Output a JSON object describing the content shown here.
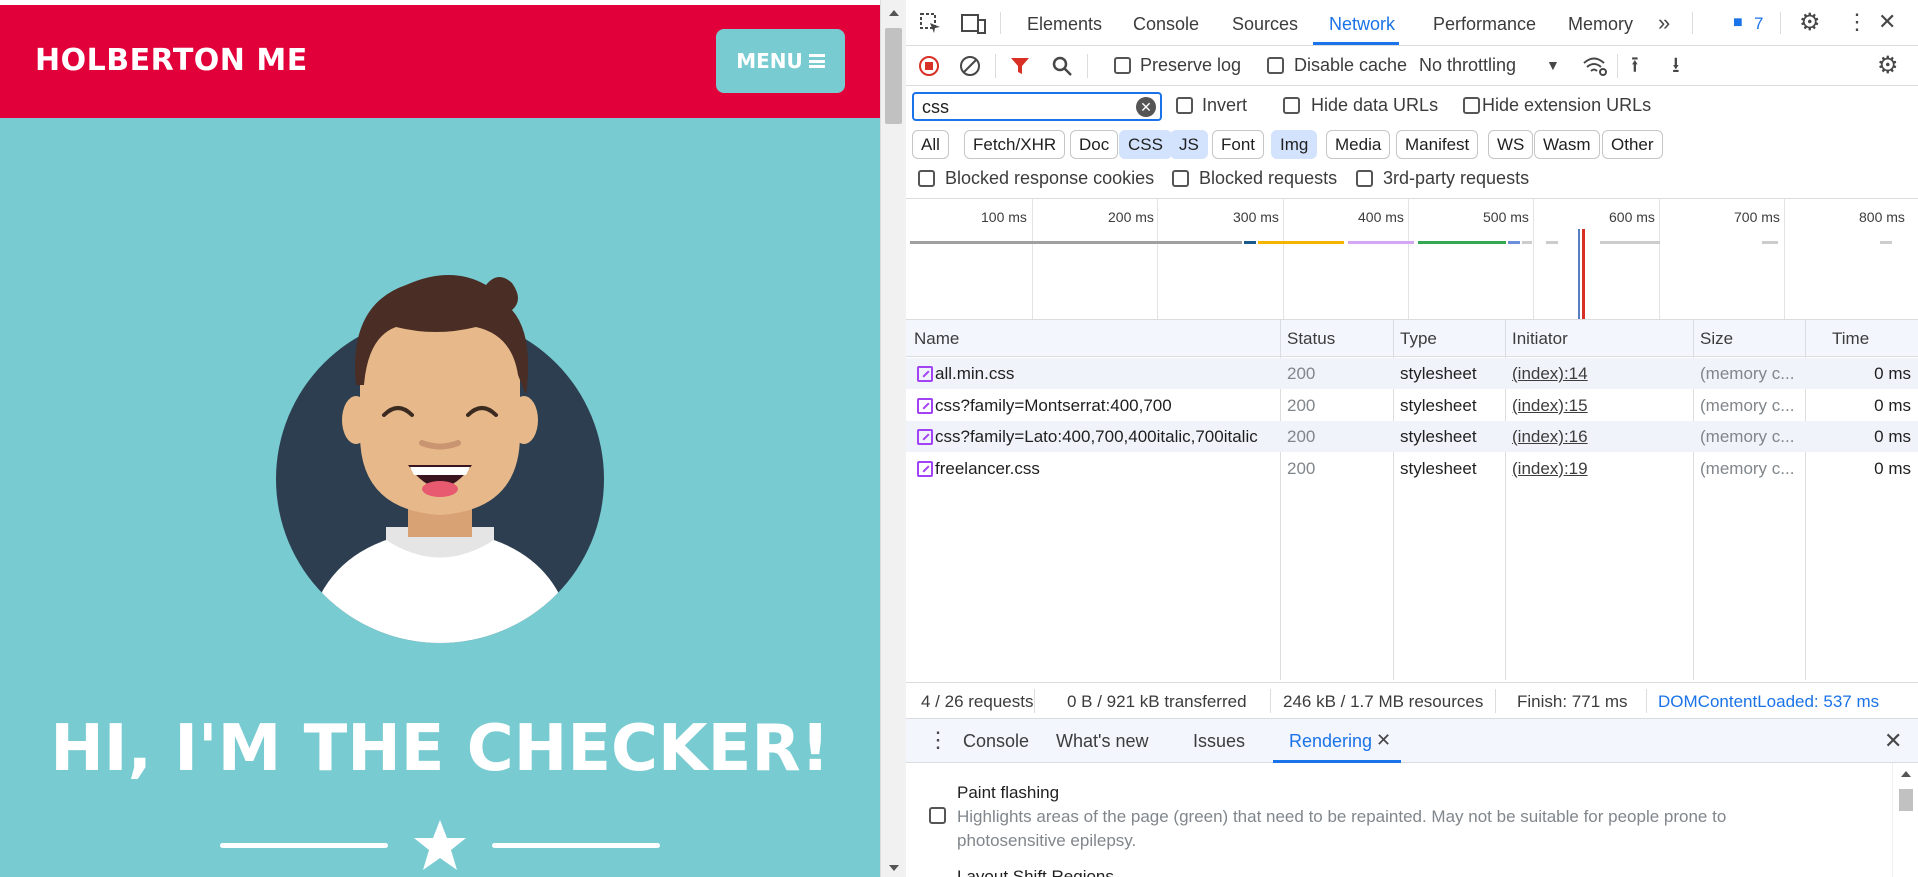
{
  "page": {
    "brand": "HOLBERTON ME",
    "menu_label": "MENU",
    "hero_title": "HI, I'M THE CHECKER!"
  },
  "devtools": {
    "tabs": [
      "Elements",
      "Console",
      "Sources",
      "Network",
      "Performance",
      "Memory"
    ],
    "active_tab": "Network",
    "issues_count": "7",
    "toolbar": {
      "preserve_log": "Preserve log",
      "disable_cache": "Disable cache",
      "throttling": "No throttling"
    },
    "filter": {
      "value": "css",
      "invert": "Invert",
      "hide_data_urls": "Hide data URLs",
      "hide_extension_urls": "Hide extension URLs"
    },
    "type_filters": [
      "All",
      "Fetch/XHR",
      "Doc",
      "CSS",
      "JS",
      "Font",
      "Img",
      "Media",
      "Manifest",
      "WS",
      "Wasm",
      "Other"
    ],
    "active_type_filters": [
      "CSS",
      "JS",
      "Img"
    ],
    "blocked": {
      "cookies": "Blocked response cookies",
      "requests": "Blocked requests",
      "third_party": "3rd-party requests"
    },
    "timeline_ticks": [
      "100 ms",
      "200 ms",
      "300 ms",
      "400 ms",
      "500 ms",
      "600 ms",
      "700 ms",
      "800 ms"
    ],
    "columns": [
      "Name",
      "Status",
      "Type",
      "Initiator",
      "Size",
      "Time"
    ],
    "requests": [
      {
        "name": "all.min.css",
        "status": "200",
        "type": "stylesheet",
        "initiator": "(index):14",
        "size": "(memory c...",
        "time": "0 ms"
      },
      {
        "name": "css?family=Montserrat:400,700",
        "status": "200",
        "type": "stylesheet",
        "initiator": "(index):15",
        "size": "(memory c...",
        "time": "0 ms"
      },
      {
        "name": "css?family=Lato:400,700,400italic,700italic",
        "status": "200",
        "type": "stylesheet",
        "initiator": "(index):16",
        "size": "(memory c...",
        "time": "0 ms"
      },
      {
        "name": "freelancer.css",
        "status": "200",
        "type": "stylesheet",
        "initiator": "(index):19",
        "size": "(memory c...",
        "time": "0 ms"
      }
    ],
    "status_bar": {
      "requests": "4 / 26 requests",
      "transferred": "0 B / 921 kB transferred",
      "resources": "246 kB / 1.7 MB resources",
      "finish": "Finish: 771 ms",
      "dcl": "DOMContentLoaded: 537 ms"
    },
    "drawer_tabs": [
      "Console",
      "What's new",
      "Issues",
      "Rendering"
    ],
    "active_drawer_tab": "Rendering",
    "rendering": {
      "paint_flashing_title": "Paint flashing",
      "paint_flashing_desc": "Highlights areas of the page (green) that need to be repainted. May not be suitable for people prone to photosensitive epilepsy.",
      "next_option": "Layout Shift Regions"
    },
    "colors": {
      "accent": "#1a73e8",
      "brand_red": "#e2003b",
      "page_teal": "#78cbd1"
    }
  }
}
